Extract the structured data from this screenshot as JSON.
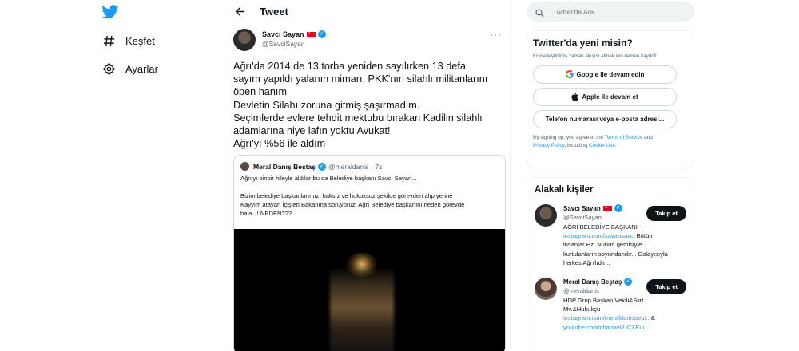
{
  "nav": {
    "explore_label": "Keşfet",
    "settings_label": "Ayarlar"
  },
  "header": {
    "title": "Tweet"
  },
  "tweet": {
    "author_name": "Savcı Sayan",
    "author_handle": "@SavciSayan",
    "text_lines": [
      "Ağrı'da 2014 de 13 torba yeniden sayılırken 13 defa",
      "sayım yapıldı yalanın mimarı, PKK'nın silahlı militanlarını",
      "öpen hanım",
      "Devletin Silahı zoruna gitmiş şaşırmadım.",
      "Seçimlerde evlere tehdit mektubu bırakan Kadilin silahlı",
      "adamlarına niye lafın yoktu Avukat!",
      "Ağrı'yı %56 ile aldım"
    ],
    "quote": {
      "author_name": "Meral Danış Beştaş",
      "author_handle": "@meraldanis",
      "time": "· 7s",
      "line1": "Ağrı'yı binbir hileyle aldılar bu da Belediye başkanı Savcı Sayan...",
      "line2": "Bizim belediye başkanlarımızı haksız ve hukuksuz şekilde görevden alıp yerine",
      "line3": "Kayyım atayan İçişleri Bakanına soruyoruz; Ağrı Belediye başkanını neden görevde",
      "line4": "hala...! NEDEN???"
    }
  },
  "search": {
    "placeholder": "Twitter'da Ara"
  },
  "signup": {
    "title": "Twitter'da yeni misin?",
    "subtitle": "Kişiselleştirilmiş zaman akışını almak için hemen kaydol!",
    "google_label": "Google ile devam edin",
    "apple_label": "Apple ile devam et",
    "phone_label": "Telefon numarası veya e-posta adresi...",
    "terms_prefix": "By signing up, you agree to the",
    "terms_link": "Terms of Service",
    "terms_and": "and",
    "privacy_link": "Privacy Policy",
    "terms_including": ", including",
    "cookie_link": "Cookie Use",
    "terms_end": "."
  },
  "related": {
    "title": "Alakalı kişiler",
    "people": [
      {
        "name": "Savcı Sayan",
        "handle": "@SavciSayan",
        "follow_label": "Takip et",
        "bio_lines": [
          "AĞRI BELEDİYE BAŞKANI -",
          "Bütün",
          "insanlar Hz. Nuhun gemisiyle",
          "kurtulanların soyundandır... Dolayısıyla",
          "herkes Ağrı'lıdır..."
        ],
        "link": "instagram.com/sayansavci"
      },
      {
        "name": "Meral Danış Beştaş",
        "handle": "@meraldanis",
        "follow_label": "Takip et",
        "bio_lines": [
          "HDP Grup Başkan Vekili&Siirt",
          "Mv.&Hukukçu",
          "&"
        ],
        "link1": "instagram.com/meraldanisbest...",
        "link2": "youtube.com/channel/UCXEui..."
      }
    ]
  },
  "colors": {
    "brand_blue": "#1d9bf0",
    "text": "#0f1419",
    "muted": "#536471"
  }
}
